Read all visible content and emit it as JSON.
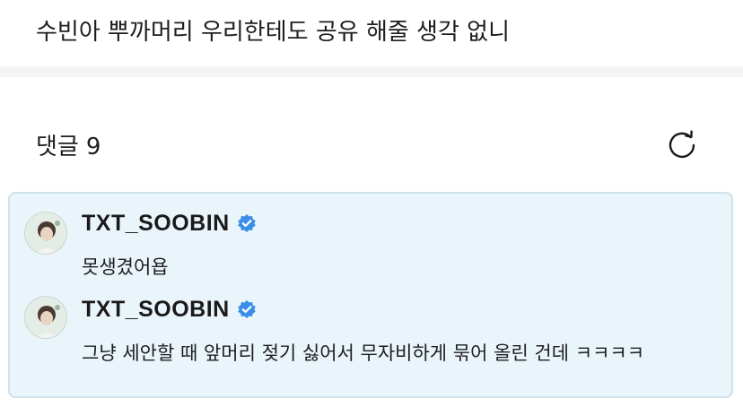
{
  "post": {
    "text": "수빈아 뿌까머리 우리한테도 공유 해줄 생각 없니"
  },
  "comments_section": {
    "label": "댓글",
    "count": "9",
    "refresh_icon": "refresh-icon"
  },
  "comments": [
    {
      "author": "TXT_SOOBIN",
      "verified": true,
      "text": "못생겼어욥"
    },
    {
      "author": "TXT_SOOBIN",
      "verified": true,
      "text": "그냥 세안할 때 앞머리 젖기 싫어서 무자비하게 묶어 올린 건데 ㅋㅋㅋㅋ"
    }
  ],
  "colors": {
    "card_background": "#eaf5fb",
    "card_border": "#cfe2ee",
    "verified_badge": "#3b8ee8",
    "divider": "#f4f4f6"
  }
}
